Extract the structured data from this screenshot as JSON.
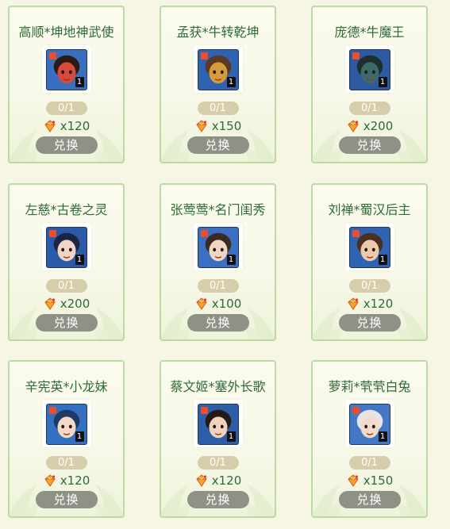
{
  "colors": {
    "name": "#2e6b35",
    "card_border": "#b9dda0",
    "button": "#8d9186",
    "count_bg": "#d6cdaa"
  },
  "cards": [
    {
      "name": "高顺*坤地神武使",
      "count": "0/1",
      "price": "x120",
      "button": "兑换",
      "level": "1",
      "portrait": {
        "skin": "#d74a3c",
        "hair": "#2b1b17",
        "bg": "#3a6fbf"
      }
    },
    {
      "name": "孟获*牛转乾坤",
      "count": "0/1",
      "price": "x150",
      "button": "兑换",
      "level": "1",
      "portrait": {
        "skin": "#d79b3a",
        "hair": "#5b3a24",
        "bg": "#2f63b2"
      }
    },
    {
      "name": "庞德*牛魔王",
      "count": "0/1",
      "price": "x200",
      "button": "兑换",
      "level": "1",
      "portrait": {
        "skin": "#3e6a68",
        "hair": "#1f2f2f",
        "bg": "#2d5aa1"
      }
    },
    {
      "name": "左慈*古卷之灵",
      "count": "0/1",
      "price": "x200",
      "button": "兑换",
      "level": "1",
      "portrait": {
        "skin": "#f1d4c6",
        "hair": "#1b2440",
        "bg": "#2a5aa8"
      }
    },
    {
      "name": "张莺莺*名门闺秀",
      "count": "0/1",
      "price": "x100",
      "button": "兑换",
      "level": "1",
      "portrait": {
        "skin": "#f3d6c0",
        "hair": "#3b2a22",
        "bg": "#3a6fc2"
      }
    },
    {
      "name": "刘禅*蜀汉后主",
      "count": "0/1",
      "price": "x120",
      "button": "兑换",
      "level": "1",
      "portrait": {
        "skin": "#f0c9a8",
        "hair": "#4a3020",
        "bg": "#2f64b4"
      }
    },
    {
      "name": "辛宪英*小龙妹",
      "count": "0/1",
      "price": "x120",
      "button": "兑换",
      "level": "1",
      "portrait": {
        "skin": "#f4d8c4",
        "hair": "#1d3a66",
        "bg": "#3470c0"
      }
    },
    {
      "name": "蔡文姬*塞外长歌",
      "count": "0/1",
      "price": "x120",
      "button": "兑换",
      "level": "1",
      "portrait": {
        "skin": "#f2d2bd",
        "hair": "#241a18",
        "bg": "#2d5ea8"
      }
    },
    {
      "name": "萝莉*茕茕白兔",
      "count": "0/1",
      "price": "x150",
      "button": "兑换",
      "level": "1",
      "portrait": {
        "skin": "#f6dac9",
        "hair": "#e7e4e4",
        "bg": "#4478c6"
      }
    }
  ]
}
